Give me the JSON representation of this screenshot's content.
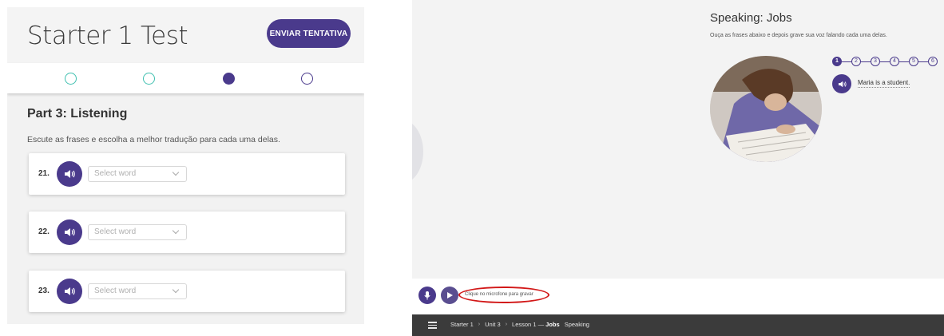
{
  "left_panel": {
    "title": "Starter 1 Test",
    "submit_label": "ENVIAR TENTATIVA",
    "steps": [
      {
        "state": "done"
      },
      {
        "state": "done"
      },
      {
        "state": "current"
      },
      {
        "state": "pending"
      }
    ],
    "part_title": "Part 3: Listening",
    "instructions": "Escute as frases e escolha a melhor tradução para cada uma delas.",
    "questions": [
      {
        "number": "21.",
        "select_value": "Select word"
      },
      {
        "number": "22.",
        "select_value": "Select word"
      },
      {
        "number": "23.",
        "select_value": "Select word"
      }
    ]
  },
  "right_panel": {
    "title": "Speaking: Jobs",
    "instructions": "Ouça as frases abaixo e depois grave sua voz falando cada uma delas.",
    "stepper": [
      "1",
      "2",
      "3",
      "4",
      "5",
      "6"
    ],
    "current_step": 1,
    "sentence": "Maria is a student.",
    "record_hint": "Clique no microfone para gravar",
    "breadcrumb": {
      "course": "Starter 1",
      "unit": "Unit 3",
      "lesson": "Lesson 1 —",
      "lesson_topic": "Jobs",
      "activity": "Speaking"
    }
  },
  "colors": {
    "accent": "#4a3a8c",
    "step_done": "#40c0b0",
    "highlight": "#d21818",
    "footer": "#3b3b3b"
  },
  "icons": [
    "speaker-icon",
    "microphone-icon",
    "play-icon",
    "menu-icon",
    "chevron-down-icon",
    "chevron-right-icon"
  ]
}
